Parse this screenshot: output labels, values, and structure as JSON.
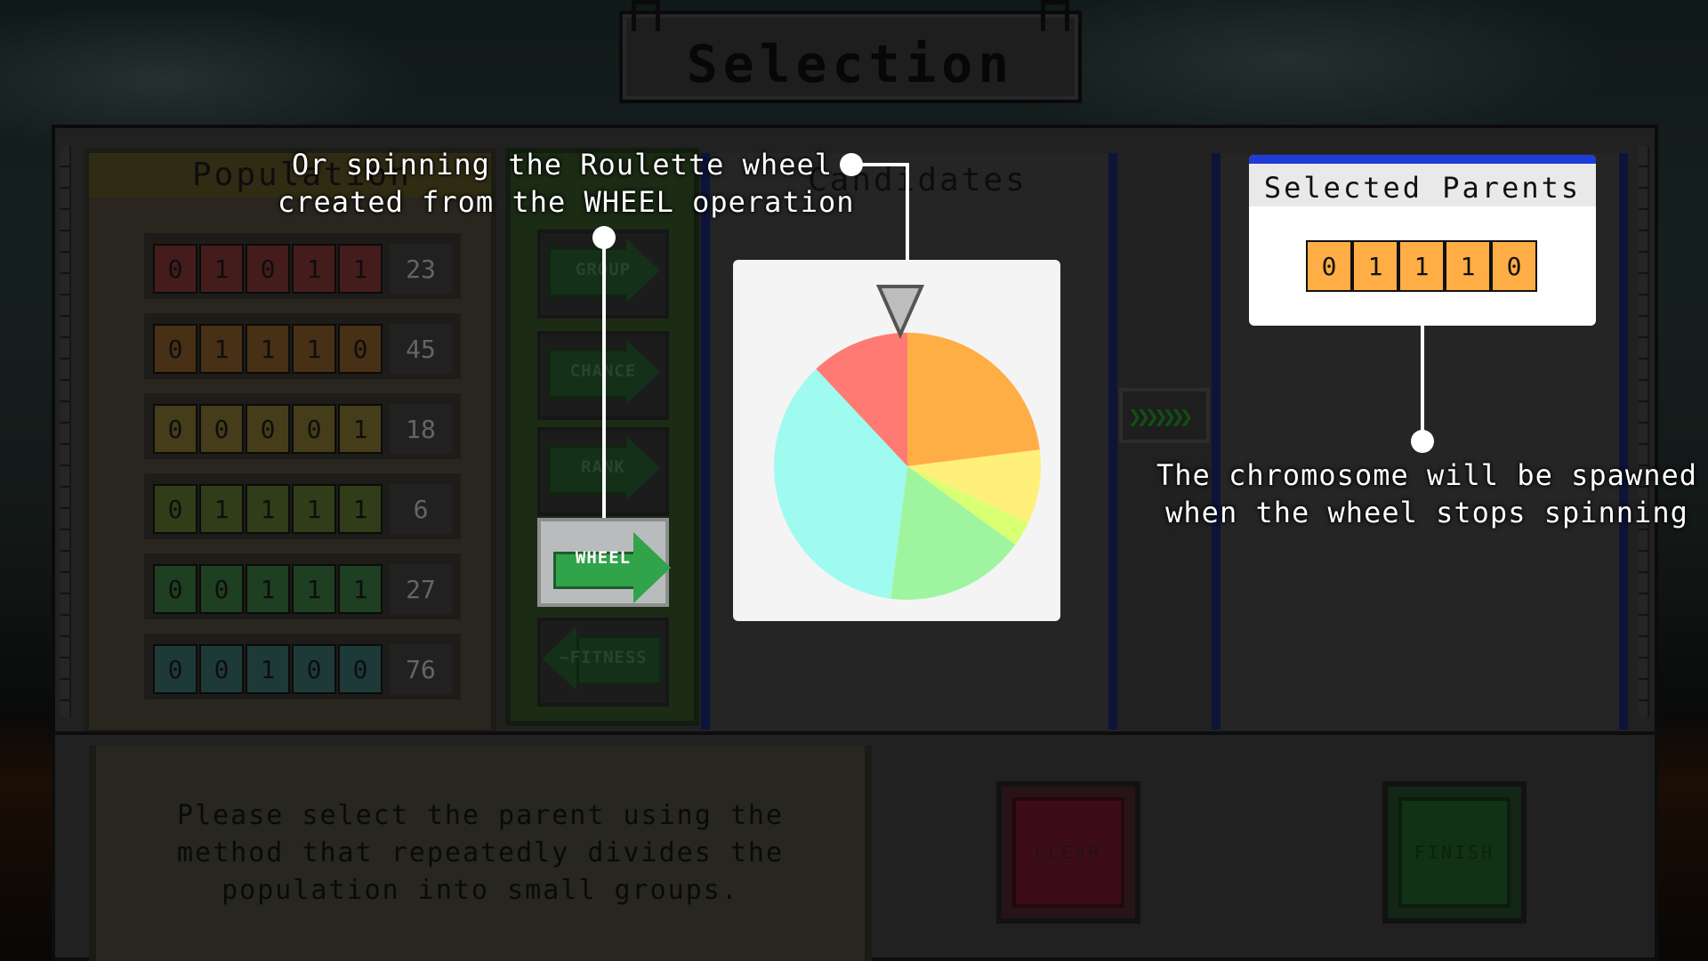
{
  "title": "Selection",
  "population": {
    "heading": "Population",
    "rows": [
      {
        "genes": [
          "0",
          "1",
          "0",
          "1",
          "1"
        ],
        "fitness": "23",
        "color": "#6b2c2c"
      },
      {
        "genes": [
          "0",
          "1",
          "1",
          "1",
          "0"
        ],
        "fitness": "45",
        "color": "#6e4a22"
      },
      {
        "genes": [
          "0",
          "0",
          "0",
          "0",
          "1"
        ],
        "fitness": "18",
        "color": "#6b5f27"
      },
      {
        "genes": [
          "0",
          "1",
          "1",
          "1",
          "1"
        ],
        "fitness": "6",
        "color": "#4a5e25"
      },
      {
        "genes": [
          "0",
          "0",
          "1",
          "1",
          "1"
        ],
        "fitness": "27",
        "color": "#2f6134"
      },
      {
        "genes": [
          "0",
          "0",
          "1",
          "0",
          "0"
        ],
        "fitness": "76",
        "color": "#2e5a57"
      }
    ]
  },
  "methods": [
    {
      "label": "GROUP",
      "active": false
    },
    {
      "label": "CHANCE",
      "active": false
    },
    {
      "label": "RANK",
      "active": false
    },
    {
      "label": "WHEEL",
      "active": true
    },
    {
      "label": "~FITNESS",
      "active": false
    }
  ],
  "candidates": {
    "heading": "Candidates"
  },
  "selected_parents": {
    "heading": "Selected Parents",
    "genes": [
      "0",
      "1",
      "1",
      "1",
      "0"
    ],
    "gene_color": "#ffad45"
  },
  "roulette_wheel": {
    "slices": [
      {
        "share": 0.12,
        "color": "#ff7a72"
      },
      {
        "share": 0.23,
        "color": "#ffad45"
      },
      {
        "share": 0.09,
        "color": "#fff07a"
      },
      {
        "share": 0.03,
        "color": "#d9ff72"
      },
      {
        "share": 0.17,
        "color": "#9ff59f"
      },
      {
        "share": 0.36,
        "color": "#9ffbef"
      }
    ],
    "pointer_color": "#bdbdbd"
  },
  "callouts": {
    "wheel_line1": "Or spinning the Roulette wheel",
    "wheel_line2": "created from the WHEEL operation",
    "spawn_line1": "The chromosome will be spawned",
    "spawn_line2": "when the wheel stops spinning"
  },
  "message": {
    "line1": "Please select the parent using the",
    "line2": "method that repeatedly divides the",
    "line3": "population into small groups."
  },
  "buttons": {
    "clear": "CLEAR",
    "finish": "FINISH"
  }
}
